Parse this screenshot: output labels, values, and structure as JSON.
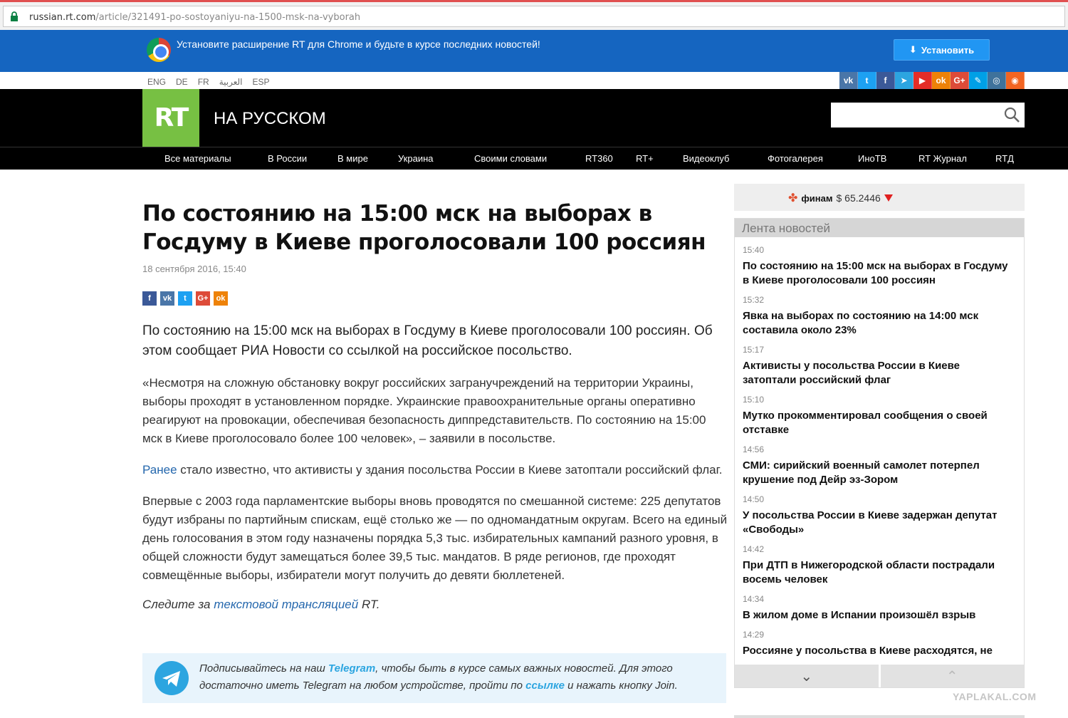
{
  "browser": {
    "url_domain": "russian.rt.com",
    "url_path": "/article/321491-po-sostoyaniyu-na-1500-msk-na-vyborah"
  },
  "banner": {
    "text": "Установите расширение RT для Chrome и будьте в курсе последних новостей!",
    "install_label": "Установить"
  },
  "languages": [
    "ENG",
    "DE",
    "FR",
    "العربية",
    "ESP"
  ],
  "socials": [
    {
      "icon": "vk-icon",
      "glyph": "vk",
      "color": "#4a76a8"
    },
    {
      "icon": "twitter-icon",
      "glyph": "t",
      "color": "#1da1f2"
    },
    {
      "icon": "facebook-icon",
      "glyph": "f",
      "color": "#3b5998"
    },
    {
      "icon": "telegram-icon",
      "glyph": "➤",
      "color": "#2ca5e0"
    },
    {
      "icon": "youtube-icon",
      "glyph": "▶",
      "color": "#e52d27"
    },
    {
      "icon": "odnoklassniki-icon",
      "glyph": "ok",
      "color": "#ee8208"
    },
    {
      "icon": "googleplus-icon",
      "glyph": "G+",
      "color": "#dd4b39"
    },
    {
      "icon": "livejournal-icon",
      "glyph": "✎",
      "color": "#00a0e6"
    },
    {
      "icon": "instagram-icon",
      "glyph": "◎",
      "color": "#3f729b"
    },
    {
      "icon": "rss-icon",
      "glyph": "◉",
      "color": "#f26522"
    }
  ],
  "header": {
    "logo": "RT",
    "title": "НА РУССКОМ",
    "search_placeholder": ""
  },
  "nav": [
    "Все материалы",
    "В России",
    "В мире",
    "Украина",
    "Своими словами",
    "RT360",
    "RT+",
    "Видеоклуб",
    "Фотогалерея",
    "ИноТВ",
    "RT Журнал",
    "RTД"
  ],
  "article": {
    "title": "По состоянию на 15:00 мск на выборах в Госдуму в Киеве проголосовали 100 россиян",
    "date": "18 сентября 2016, 15:40",
    "share": [
      {
        "icon": "facebook-share-icon",
        "glyph": "f",
        "color": "#3b5998"
      },
      {
        "icon": "vk-share-icon",
        "glyph": "vk",
        "color": "#4a76a8"
      },
      {
        "icon": "twitter-share-icon",
        "glyph": "t",
        "color": "#1da1f2"
      },
      {
        "icon": "googleplus-share-icon",
        "glyph": "G+",
        "color": "#dd4b39"
      },
      {
        "icon": "odnoklassniki-share-icon",
        "glyph": "ok",
        "color": "#ee8208"
      }
    ],
    "lead": "По состоянию на 15:00 мск на выборах в Госдуму в Киеве проголосовали 100 россиян. Об этом сообщает РИА Новости со ссылкой на российское посольство.",
    "p1": "«Несмотря на сложную обстановку вокруг российских загранучреждений на территории Украины, выборы проходят в установленном порядке. Украинские правоохранительные органы оперативно реагируют на провокации, обеспечивая безопасность диппредставительств. По состоянию на 15:00 мск в Киеве проголосовало более 100 человек», – заявили в посольстве.",
    "p2_link": "Ранее",
    "p2_rest": " стало известно, что активисты у здания посольства России в Киеве затоптали российский флаг.",
    "p3": "Впервые с 2003 года парламентские выборы вновь проводятся по смешанной системе: 225 депутатов будут избраны по партийным спискам, ещё столько же — по одномандатным округам. Всего на единый день голосования в этом году назначены порядка 5,3 тыс. избирательных кампаний разного уровня, в общей сложности будут замещаться более 39,5 тыс. мандатов. В ряде регионов, где проходят совмещённые выборы, избиратели могут получить до девяти бюллетеней.",
    "follow_pre": "Следите за ",
    "follow_link": "текстовой трансляцией",
    "follow_post": " RT.",
    "telegram": {
      "pre": "Подписывайтесь на наш ",
      "brand": "Telegram",
      "mid": ", чтобы быть в курсе самых важных новостей. Для этого достаточно иметь Telegram на любом устройстве, пройти по ",
      "link": "ссылке",
      "post": " и нажать кнопку Join."
    }
  },
  "finam": {
    "logo": "финам",
    "rate": "$ 65.2446",
    "trend": "down"
  },
  "feed": {
    "title": "Лента новостей",
    "items": [
      {
        "time": "15:40",
        "headline": "По состоянию на 15:00 мск на выборах в Госдуму в Киеве проголосовали 100 россиян"
      },
      {
        "time": "15:32",
        "headline": "Явка на выборах по состоянию на 14:00 мск составила около 23%"
      },
      {
        "time": "15:17",
        "headline": "Активисты у посольства России в Киеве затоптали российский флаг"
      },
      {
        "time": "15:10",
        "headline": "Мутко прокомментировал сообщения о своей отставке"
      },
      {
        "time": "14:56",
        "headline": "СМИ: сирийский военный самолет потерпел крушение под Дейр эз-Зором"
      },
      {
        "time": "14:50",
        "headline": "У посольства России в Киеве задержан депутат «Свободы»"
      },
      {
        "time": "14:42",
        "headline": "При ДТП в Нижегородской области пострадали восемь человек"
      },
      {
        "time": "14:34",
        "headline": "В жилом доме в Испании произошёл взрыв"
      },
      {
        "time": "14:29",
        "headline": "Россияне у посольства в Киеве расходятся, не"
      }
    ]
  },
  "watermark": "YAPLAKAL.COM"
}
